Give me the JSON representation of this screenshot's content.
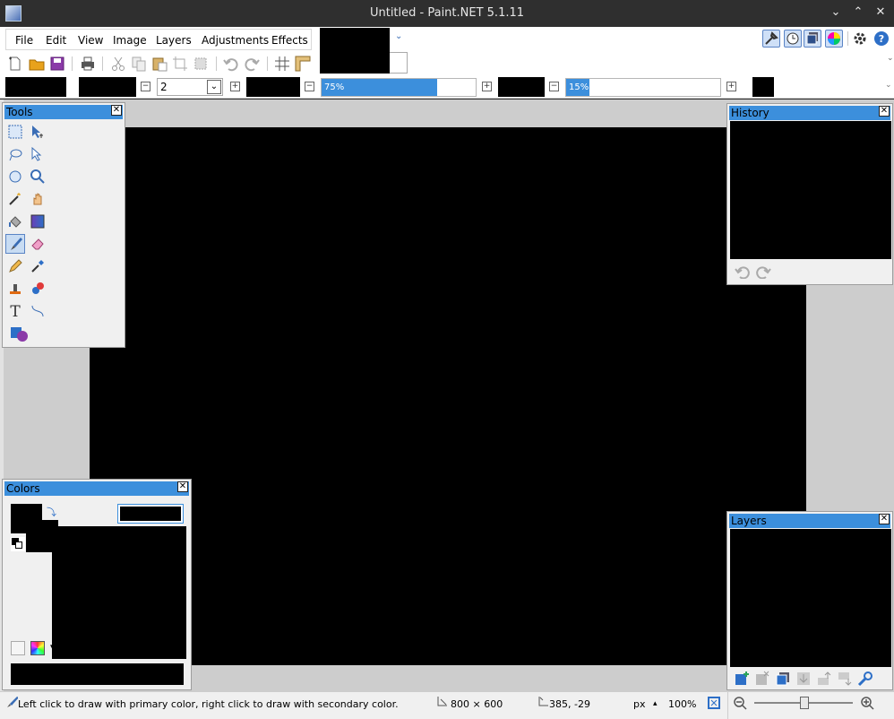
{
  "window": {
    "title": "Untitled - Paint.NET 5.1.11",
    "minimize_glyph": "⌄",
    "maximize_glyph": "⌃",
    "close_glyph": "✕"
  },
  "menu": {
    "items": [
      {
        "label": "File"
      },
      {
        "label": "Edit"
      },
      {
        "label": "View"
      },
      {
        "label": "Image"
      },
      {
        "label": "Layers"
      },
      {
        "label": "Adjustments"
      },
      {
        "label": "Effects"
      }
    ]
  },
  "options_bar": {
    "brush_width_value": "2",
    "hardness_value": "75%",
    "hardness_fraction": 0.75,
    "fill_value": "15%",
    "fill_fraction": 0.15
  },
  "panels": {
    "tools": {
      "title": "Tools"
    },
    "history": {
      "title": "History"
    },
    "layers": {
      "title": "Layers"
    },
    "colors": {
      "title": "Colors"
    }
  },
  "status": {
    "hint": "Left click to draw with primary color, right click to draw with secondary color.",
    "image_size": "800 × 600",
    "cursor_pos": "385, -29",
    "units": "px",
    "zoom": "100%"
  },
  "colors": {
    "accent": "#3c8fdc",
    "canvas": "#000000",
    "workspace": "#cdcdcd"
  }
}
